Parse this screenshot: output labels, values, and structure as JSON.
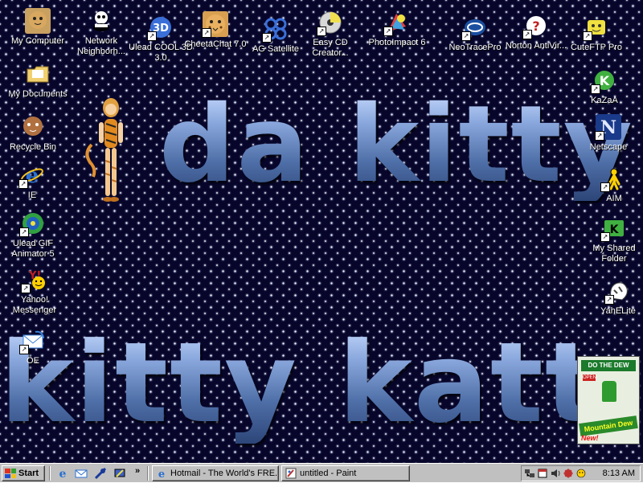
{
  "desktop": {
    "text_top": "da kitty",
    "text_bottom": "kitty katt",
    "icons": [
      {
        "id": "my-computer",
        "label": "My Computer",
        "icon": "my-computer-icon",
        "shortcut": false,
        "color": "#c8a060"
      },
      {
        "id": "network",
        "label": "Network Neighborh...",
        "icon": "network-neighborhood-icon",
        "shortcut": false,
        "color": "#ffffff"
      },
      {
        "id": "ulead-cool-3d",
        "label": "Ulead COOL 3D 3.0",
        "icon": "ulead-cool-3d-icon",
        "shortcut": true,
        "color": "#3a6fd8"
      },
      {
        "id": "cheetachat",
        "label": "CheetaChat 7.0",
        "icon": "cheetah-icon",
        "shortcut": true,
        "color": "#d8a050"
      },
      {
        "id": "ag-satellite",
        "label": "AG Satellite",
        "icon": "satellite-icon",
        "shortcut": true,
        "color": "#3a6fd8"
      },
      {
        "id": "easy-cd",
        "label": "Easy CD Creator...",
        "icon": "cd-creator-icon",
        "shortcut": true,
        "color": "#d0d0d0"
      },
      {
        "id": "photoimpact",
        "label": "PhotoImpact 6",
        "icon": "photoimpact-icon",
        "shortcut": true,
        "color": "#e04040"
      },
      {
        "id": "neotracepro",
        "label": "NeoTracePro",
        "icon": "neotrace-icon",
        "shortcut": true,
        "color": "#1a4fa0"
      },
      {
        "id": "norton",
        "label": "Norton AntiVir...",
        "icon": "norton-antivirus-icon",
        "shortcut": true,
        "color": "#ffd000"
      },
      {
        "id": "cuteftp",
        "label": "CuteFTP Pro",
        "icon": "cuteftp-icon",
        "shortcut": true,
        "color": "#f0e040"
      },
      {
        "id": "my-documents",
        "label": "My Documents",
        "icon": "folder-icon",
        "shortcut": false,
        "color": "#f0d070"
      },
      {
        "id": "recycle-bin",
        "label": "Recycle Bin",
        "icon": "recycle-bin-icon",
        "shortcut": false,
        "color": "#b07040"
      },
      {
        "id": "ie",
        "label": "IE",
        "icon": "internet-explorer-icon",
        "shortcut": true,
        "color": "#2a70d0"
      },
      {
        "id": "ulead-gif",
        "label": "Ulead GIF Animator 5",
        "icon": "gif-animator-icon",
        "shortcut": true,
        "color": "#30a040"
      },
      {
        "id": "yahoo-messenger",
        "label": "Yahoo! Messenger",
        "icon": "yahoo-messenger-icon",
        "shortcut": true,
        "color": "#ffd000"
      },
      {
        "id": "oe",
        "label": "OE",
        "icon": "outlook-express-icon",
        "shortcut": true,
        "color": "#3a80d8"
      },
      {
        "id": "kazaa",
        "label": "KaZaA",
        "icon": "kazaa-icon",
        "shortcut": true,
        "color": "#40b040"
      },
      {
        "id": "netscape",
        "label": "Netscape",
        "icon": "netscape-icon",
        "shortcut": true,
        "color": "#1a3a8a"
      },
      {
        "id": "aim",
        "label": "AIM",
        "icon": "aim-icon",
        "shortcut": true,
        "color": "#ffd000"
      },
      {
        "id": "shared-folder",
        "label": "My Shared Folder",
        "icon": "shared-folder-icon",
        "shortcut": true,
        "color": "#40b040"
      },
      {
        "id": "yahelite",
        "label": "YahELite",
        "icon": "yahelite-icon",
        "shortcut": true,
        "color": "#ffffff"
      }
    ],
    "ad": {
      "banner": "DO THE DEW",
      "open": "OPEN",
      "brand": "Mountain Dew",
      "badge": "New!"
    }
  },
  "taskbar": {
    "start_label": "Start",
    "quick_launch": [
      {
        "id": "ie",
        "icon": "internet-explorer-icon"
      },
      {
        "id": "outlook",
        "icon": "outlook-express-icon"
      },
      {
        "id": "channels",
        "icon": "channels-icon"
      },
      {
        "id": "desktop",
        "icon": "show-desktop-icon"
      }
    ],
    "quick_launch_more": "»",
    "tasks": [
      {
        "id": "hotmail",
        "label": "Hotmail - The World's FRE...",
        "icon": "internet-explorer-icon"
      },
      {
        "id": "paint",
        "label": "untitled - Paint",
        "icon": "paint-icon"
      }
    ],
    "tray_icons": [
      "network-icon",
      "scheduler-icon",
      "volume-icon",
      "antivirus-icon",
      "yahoo-tray-icon"
    ],
    "clock": "8:13 AM"
  }
}
